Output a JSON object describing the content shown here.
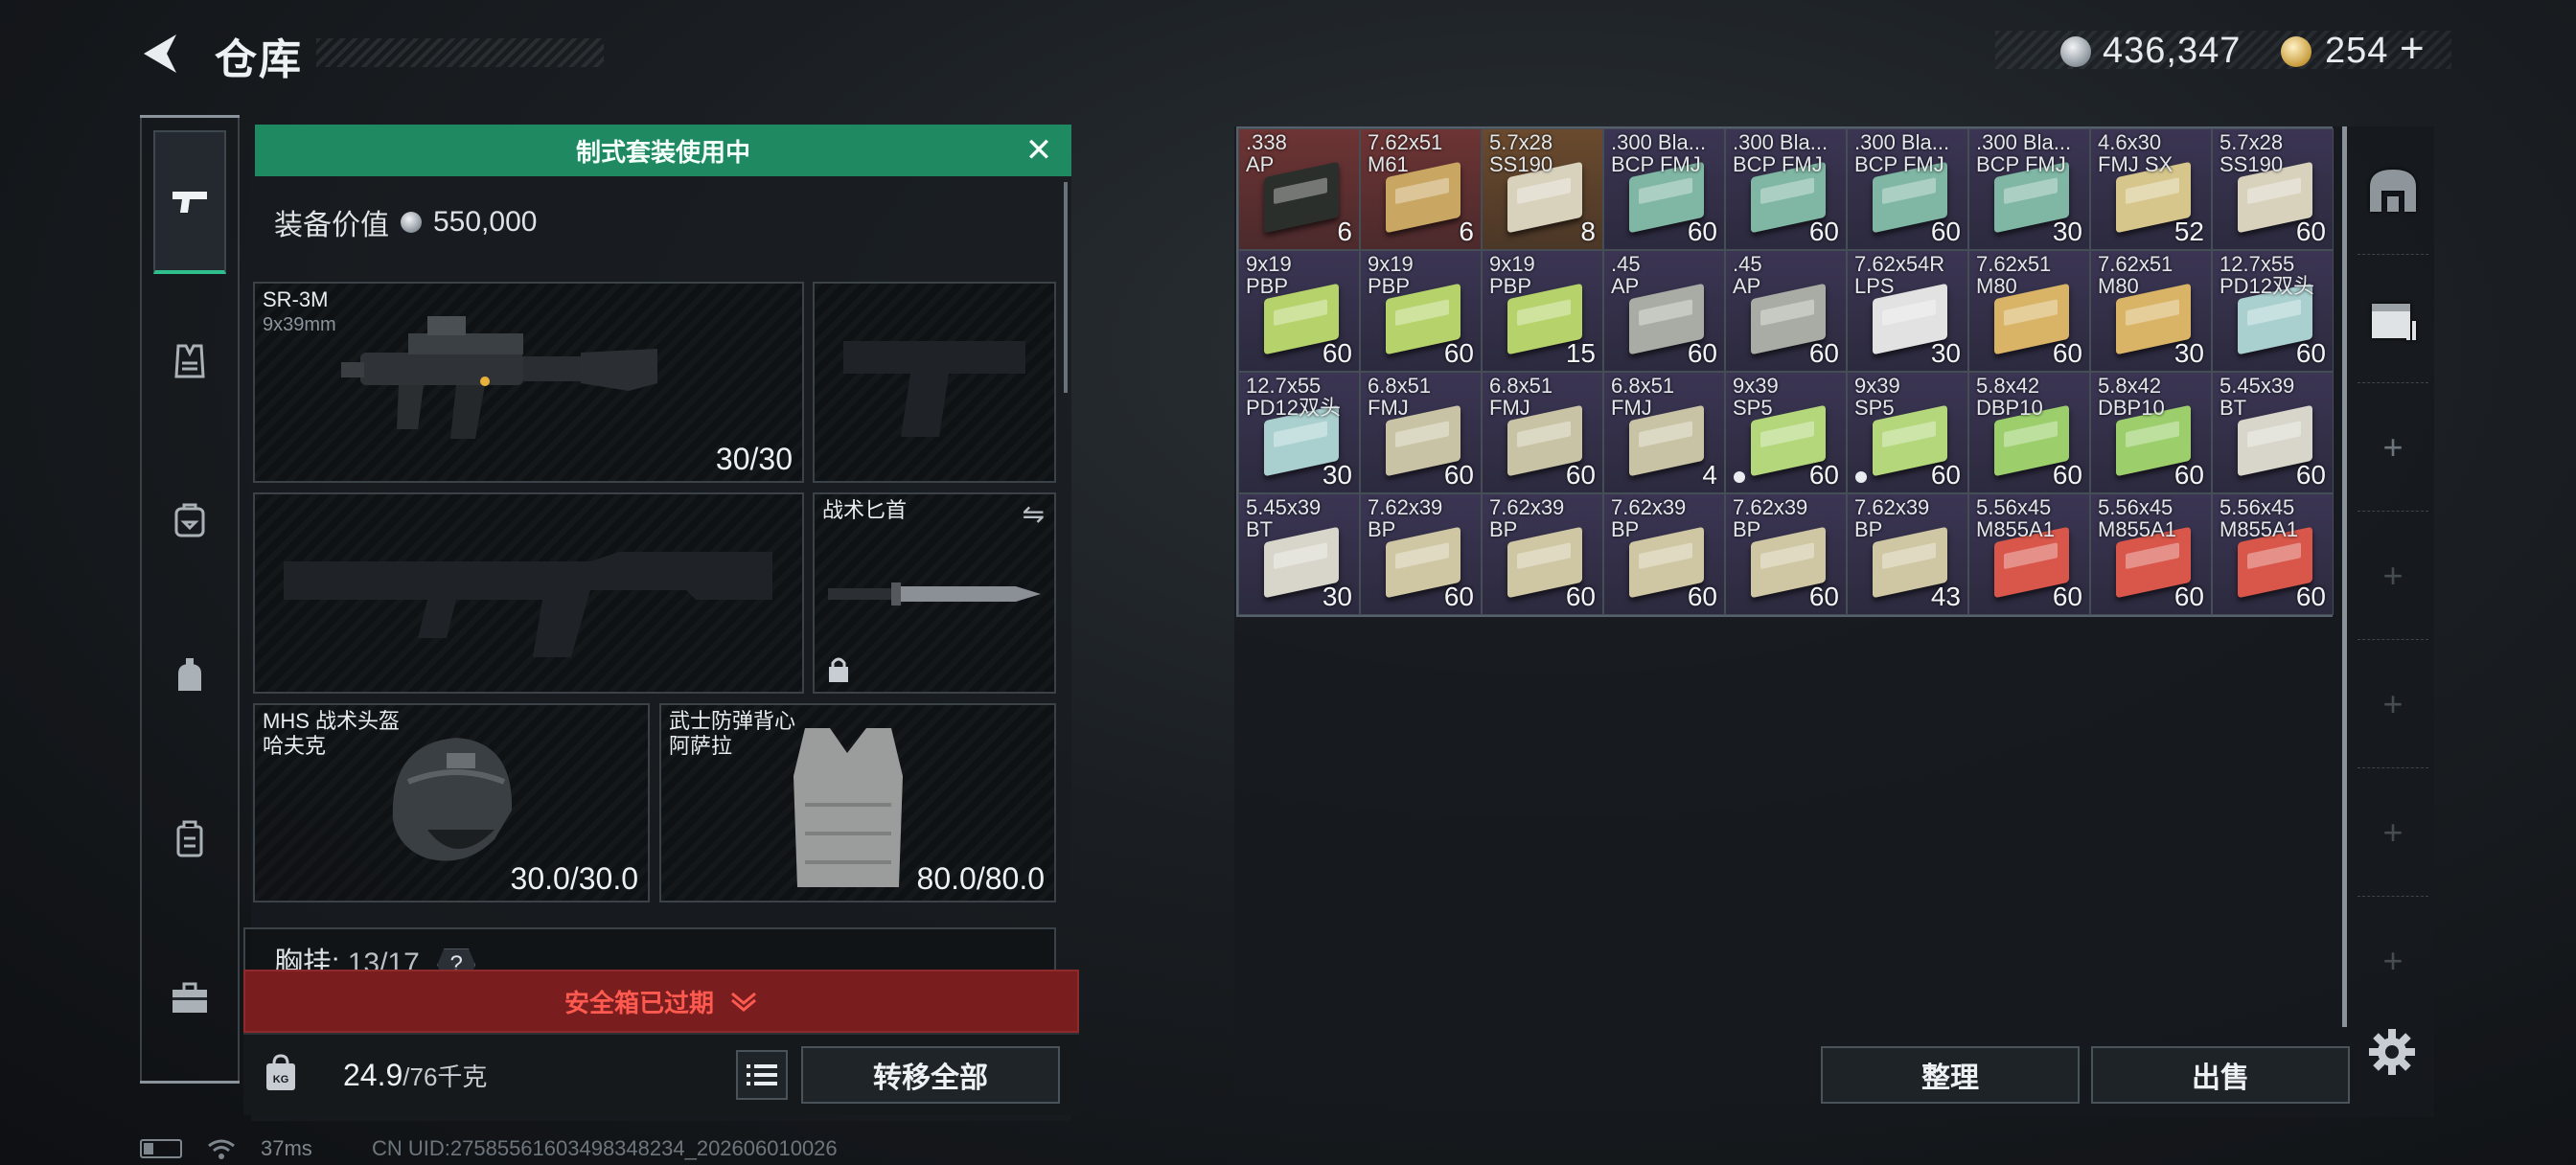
{
  "header": {
    "title": "仓库",
    "currency_silver": "436,347",
    "currency_gold": "254",
    "add_symbol": "+"
  },
  "loadout": {
    "banner": "制式套装使用中",
    "gear_value_label": "装备价值",
    "gear_value": "550,000",
    "primary": {
      "name": "SR-3M",
      "caliber": "9x39mm",
      "ammo": "30/30"
    },
    "knife": {
      "name": "战术匕首"
    },
    "helmet": {
      "name": "MHS 战术头盔",
      "map": "哈夫克",
      "durability": "30.0/30.0"
    },
    "armor": {
      "name": "武士防弹背心",
      "map": "阿萨拉",
      "durability": "80.0/80.0"
    },
    "chest_rig": {
      "label": "胸挂:",
      "used": "13",
      "capacity": "/17",
      "help": "?"
    },
    "safebox": "安全箱已过期",
    "weight_value": "24.9",
    "weight_unit": "/76千克",
    "weight_icon_label": "KG",
    "transfer_all": "转移全部"
  },
  "storage": {
    "items": [
      {
        "t1": ".338",
        "t2": "AP",
        "q": "6",
        "rarity": "red",
        "box": "#2b2f2b"
      },
      {
        "t1": "7.62x51",
        "t2": "M61",
        "q": "6",
        "rarity": "red",
        "box": "#c9a763"
      },
      {
        "t1": "5.7x28",
        "t2": "SS190",
        "q": "8",
        "rarity": "gold",
        "box": "#d8d2bd"
      },
      {
        "t1": ".300 Bla...",
        "t2": "BCP FMJ",
        "q": "60",
        "rarity": "purple",
        "box": "#7fb7a4"
      },
      {
        "t1": ".300 Bla...",
        "t2": "BCP FMJ",
        "q": "60",
        "rarity": "purple",
        "box": "#7fb7a4"
      },
      {
        "t1": ".300 Bla...",
        "t2": "BCP FMJ",
        "q": "60",
        "rarity": "purple",
        "box": "#7fb7a4"
      },
      {
        "t1": ".300 Bla...",
        "t2": "BCP FMJ",
        "q": "30",
        "rarity": "purple",
        "box": "#7fb7a4"
      },
      {
        "t1": "4.6x30",
        "t2": "FMJ SX",
        "q": "52",
        "rarity": "purple",
        "box": "#d6c68c"
      },
      {
        "t1": "5.7x28",
        "t2": "SS190",
        "q": "60",
        "rarity": "purple",
        "box": "#d8d2bd"
      },
      {
        "t1": "9x19",
        "t2": "PBP",
        "q": "60",
        "rarity": "purple",
        "box": "#b5d36a"
      },
      {
        "t1": "9x19",
        "t2": "PBP",
        "q": "60",
        "rarity": "purple",
        "box": "#b5d36a"
      },
      {
        "t1": "9x19",
        "t2": "PBP",
        "q": "15",
        "rarity": "purple",
        "box": "#b5d36a"
      },
      {
        "t1": ".45",
        "t2": "AP",
        "q": "60",
        "rarity": "purple",
        "box": "#a9aca4"
      },
      {
        "t1": ".45",
        "t2": "AP",
        "q": "60",
        "rarity": "purple",
        "box": "#a9aca4"
      },
      {
        "t1": "7.62x54R",
        "t2": "LPS",
        "q": "30",
        "rarity": "purple",
        "box": "#e2e2e2"
      },
      {
        "t1": "7.62x51",
        "t2": "M80",
        "q": "60",
        "rarity": "purple",
        "box": "#d9b466"
      },
      {
        "t1": "7.62x51",
        "t2": "M80",
        "q": "30",
        "rarity": "purple",
        "box": "#d9b466"
      },
      {
        "t1": "12.7x55",
        "t2": "PD12双头",
        "q": "60",
        "rarity": "purple",
        "box": "#a9d0cf"
      },
      {
        "t1": "12.7x55",
        "t2": "PD12双头",
        "q": "30",
        "rarity": "purple",
        "box": "#a9d0cf"
      },
      {
        "t1": "6.8x51",
        "t2": "FMJ",
        "q": "60",
        "rarity": "purple",
        "box": "#c8c3a4"
      },
      {
        "t1": "6.8x51",
        "t2": "FMJ",
        "q": "60",
        "rarity": "purple",
        "box": "#c8c3a4"
      },
      {
        "t1": "6.8x51",
        "t2": "FMJ",
        "q": "4",
        "rarity": "purple",
        "box": "#c8c3a4"
      },
      {
        "t1": "9x39",
        "t2": "SP5",
        "q": "60",
        "rarity": "purple",
        "box": "#b3d77a",
        "dot": true
      },
      {
        "t1": "9x39",
        "t2": "SP5",
        "q": "60",
        "rarity": "purple",
        "box": "#b3d77a",
        "dot": true
      },
      {
        "t1": "5.8x42",
        "t2": "DBP10",
        "q": "60",
        "rarity": "purple",
        "box": "#9ccf6c"
      },
      {
        "t1": "5.8x42",
        "t2": "DBP10",
        "q": "60",
        "rarity": "purple",
        "box": "#9ccf6c"
      },
      {
        "t1": "5.45x39",
        "t2": "BT",
        "q": "60",
        "rarity": "purple",
        "box": "#d8d6cb"
      },
      {
        "t1": "5.45x39",
        "t2": "BT",
        "q": "30",
        "rarity": "purple",
        "box": "#d8d6cb"
      },
      {
        "t1": "7.62x39",
        "t2": "BP",
        "q": "60",
        "rarity": "purple",
        "box": "#cfc7a4"
      },
      {
        "t1": "7.62x39",
        "t2": "BP",
        "q": "60",
        "rarity": "purple",
        "box": "#cfc7a4"
      },
      {
        "t1": "7.62x39",
        "t2": "BP",
        "q": "60",
        "rarity": "purple",
        "box": "#cfc7a4"
      },
      {
        "t1": "7.62x39",
        "t2": "BP",
        "q": "60",
        "rarity": "purple",
        "box": "#cfc7a4"
      },
      {
        "t1": "7.62x39",
        "t2": "BP",
        "q": "43",
        "rarity": "purple",
        "box": "#cfc7a4"
      },
      {
        "t1": "5.56x45",
        "t2": "M855A1",
        "q": "60",
        "rarity": "purple",
        "box": "#d8574a"
      },
      {
        "t1": "5.56x45",
        "t2": "M855A1",
        "q": "60",
        "rarity": "purple",
        "box": "#d8574a"
      },
      {
        "t1": "5.56x45",
        "t2": "M855A1",
        "q": "60",
        "rarity": "purple",
        "box": "#d8574a"
      }
    ],
    "add_symbol": "+",
    "sort_label": "整理",
    "sell_label": "出售"
  },
  "status": {
    "ping": "37ms",
    "uid": "CN UID:27585561603498348234_202606010026"
  },
  "colors": {
    "accent_green": "#1f8a61",
    "safebox_red": "#7a1d1f",
    "rarity_red": "#6d3434",
    "rarity_gold": "#6a4a2e",
    "rarity_purple": "#3b3553"
  }
}
